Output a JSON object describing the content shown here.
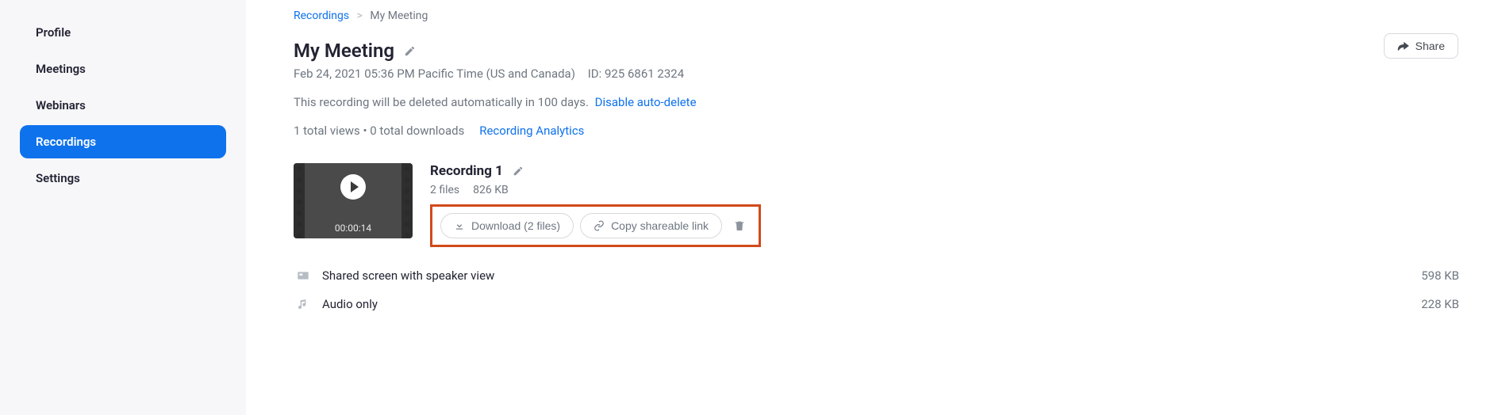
{
  "sidebar": {
    "items": [
      {
        "label": "Profile",
        "active": false
      },
      {
        "label": "Meetings",
        "active": false
      },
      {
        "label": "Webinars",
        "active": false
      },
      {
        "label": "Recordings",
        "active": true
      },
      {
        "label": "Settings",
        "active": false
      }
    ]
  },
  "breadcrumb": {
    "root": "Recordings",
    "current": "My Meeting"
  },
  "header": {
    "title": "My Meeting",
    "datetime": "Feb 24, 2021 05:36 PM Pacific Time (US and Canada)",
    "meeting_id_label": "ID: 925 6861 2324",
    "share_label": "Share"
  },
  "delete_notice": {
    "text": "This recording will be deleted automatically in 100 days.",
    "disable_link": "Disable auto-delete"
  },
  "stats": {
    "text": "1 total views • 0 total downloads",
    "analytics_link": "Recording Analytics"
  },
  "recording": {
    "title": "Recording 1",
    "file_count": "2 files",
    "total_size": "826 KB",
    "duration": "00:00:14",
    "download_label": "Download (2 files)",
    "copy_link_label": "Copy shareable link"
  },
  "files": [
    {
      "name": "Shared screen with speaker view",
      "size": "598 KB",
      "type": "video"
    },
    {
      "name": "Audio only",
      "size": "228 KB",
      "type": "audio"
    }
  ]
}
